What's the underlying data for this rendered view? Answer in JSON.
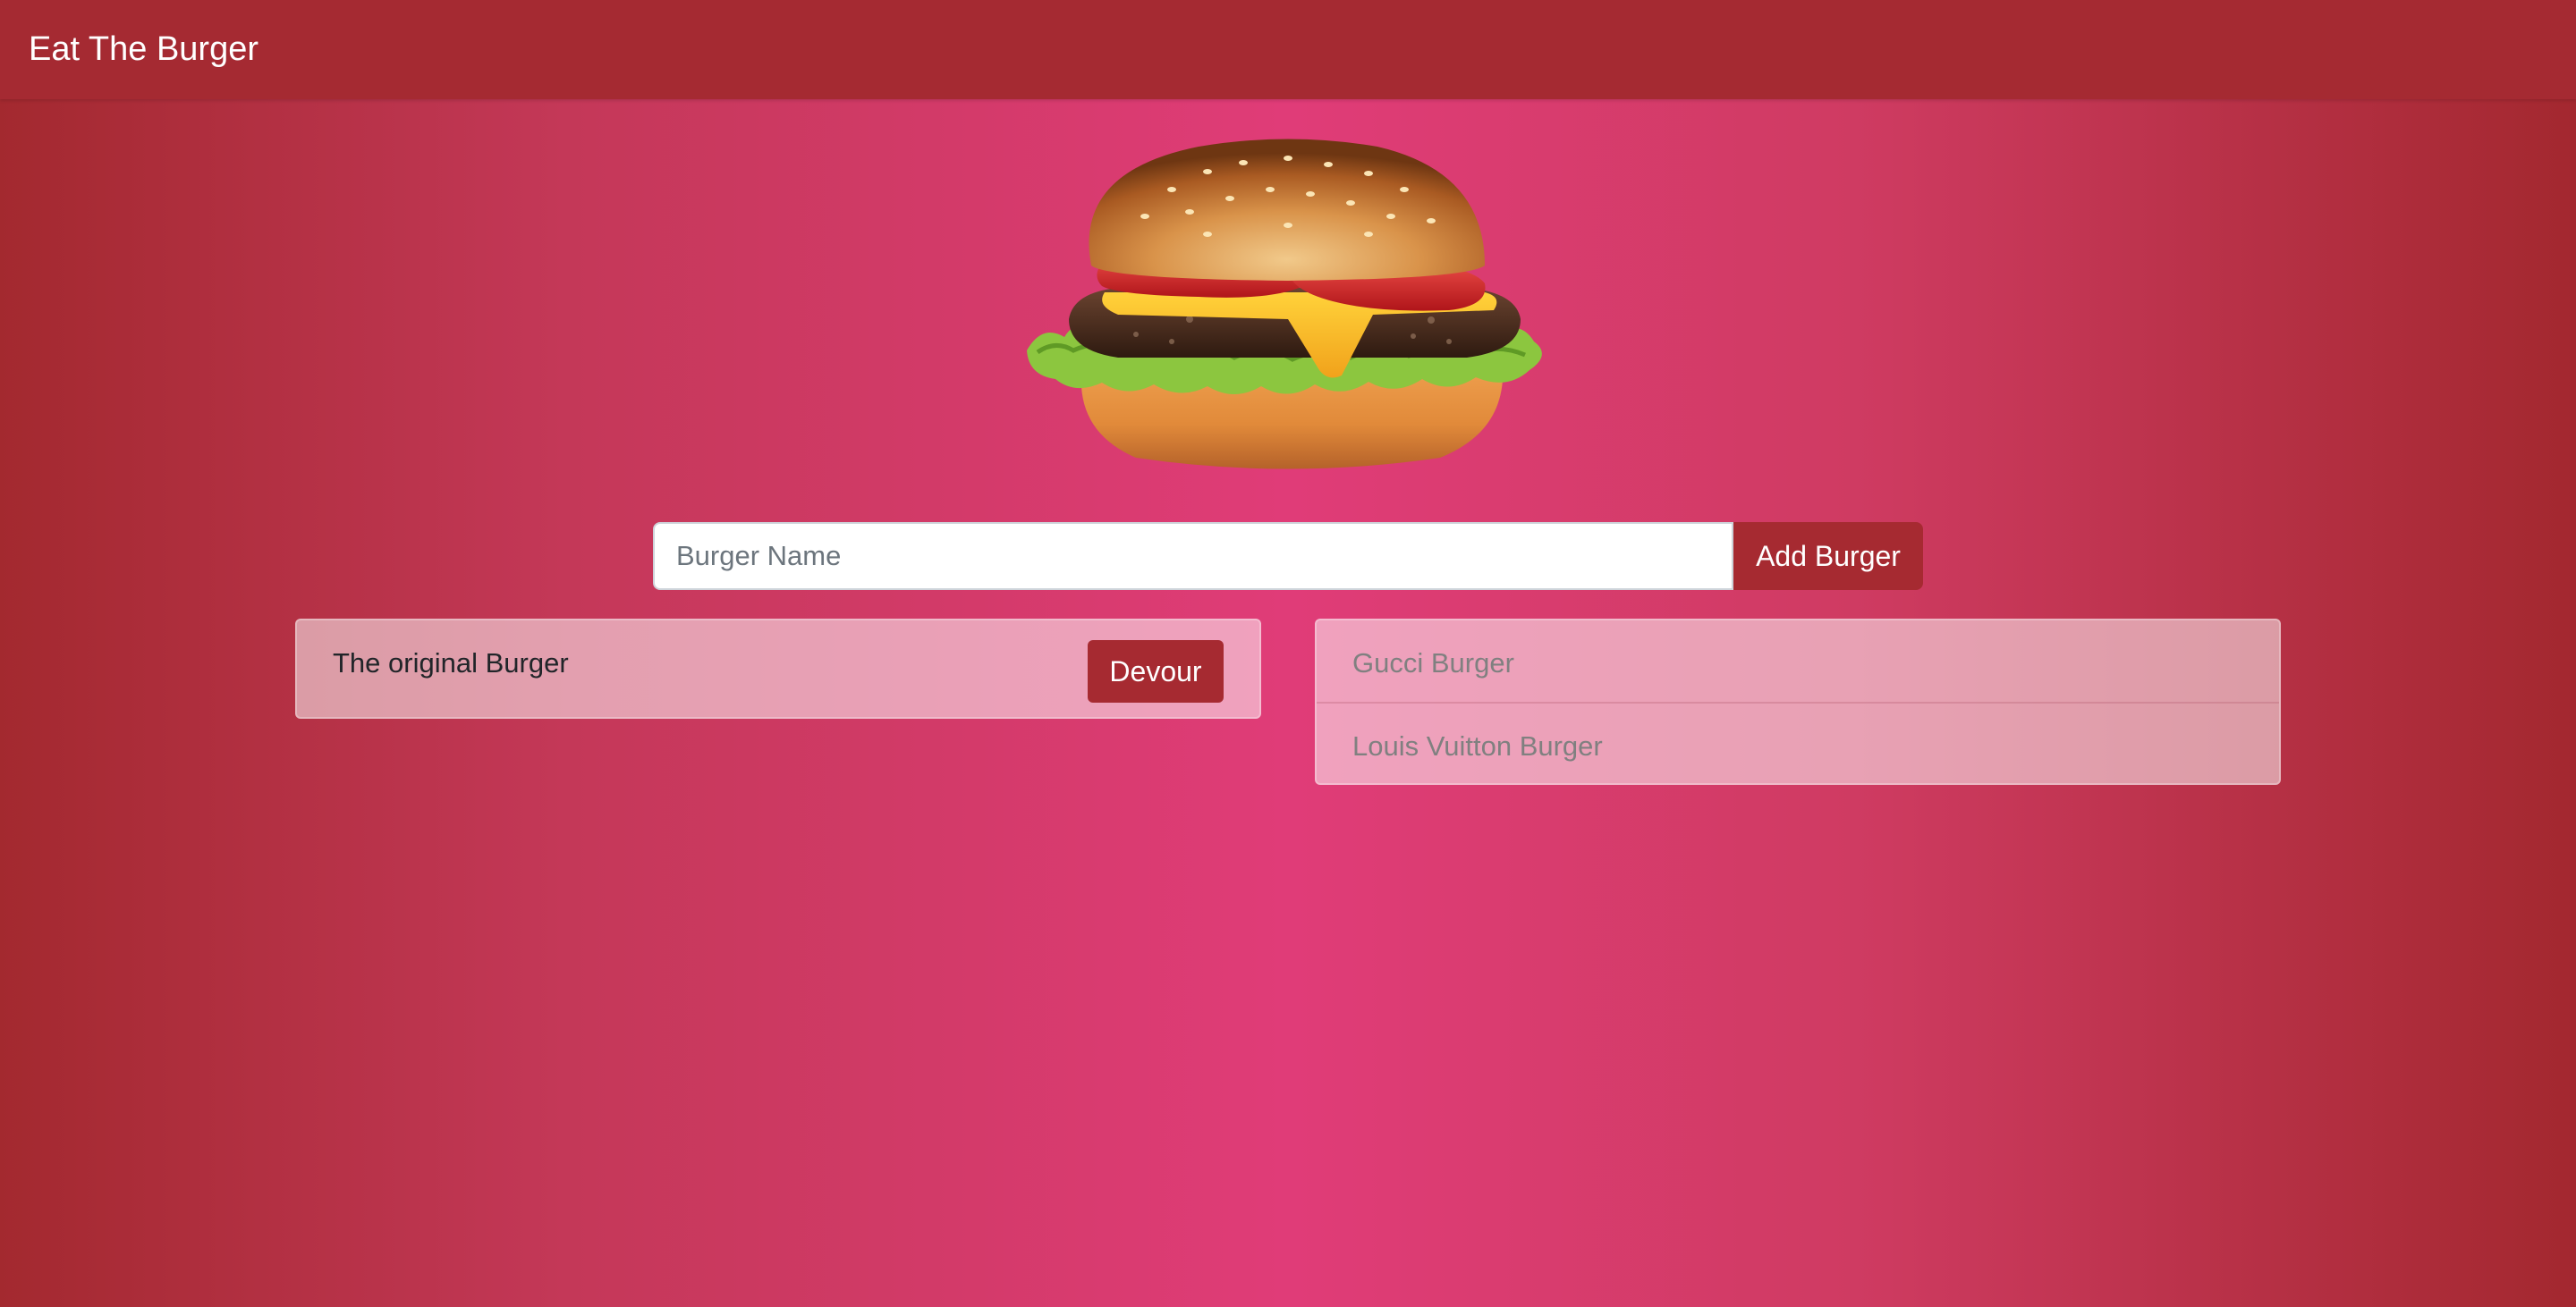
{
  "navbar": {
    "brand": "Eat The Burger"
  },
  "hero": {
    "image": "hamburger-illustration"
  },
  "form": {
    "placeholder": "Burger Name",
    "value": "",
    "submit_label": "Add Burger"
  },
  "uneaten": [
    {
      "name": "The original Burger",
      "action_label": "Devour"
    }
  ],
  "devoured": [
    {
      "name": "Gucci Burger"
    },
    {
      "name": "Louis Vuitton Burger"
    }
  ],
  "colors": {
    "brand": "#a52a32",
    "gradient_center": "#e03c78",
    "gradient_edge": "#a3292f",
    "button": "#a62a31"
  }
}
